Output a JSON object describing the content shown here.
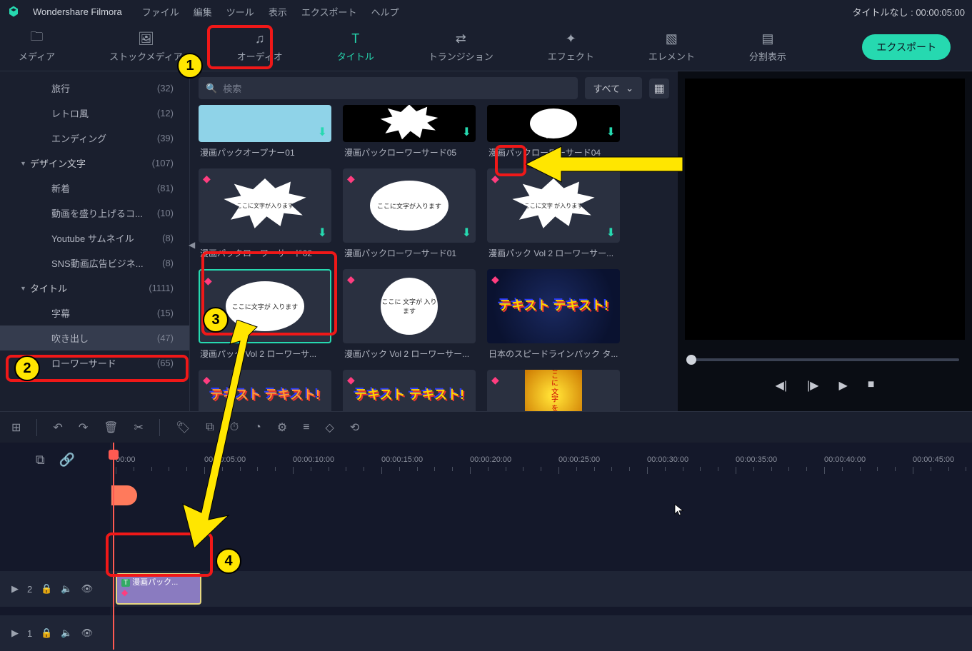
{
  "app": {
    "name": "Wondershare Filmora",
    "title_right": "タイトルなし : 00:00:05:00"
  },
  "menu": [
    "ファイル",
    "編集",
    "ツール",
    "表示",
    "エクスポート",
    "ヘルプ"
  ],
  "tabs": [
    {
      "label": "メディア"
    },
    {
      "label": "ストックメディア"
    },
    {
      "label": "オーディオ"
    },
    {
      "label": "タイトル"
    },
    {
      "label": "トランジション"
    },
    {
      "label": "エフェクト"
    },
    {
      "label": "エレメント"
    },
    {
      "label": "分割表示"
    }
  ],
  "export_label": "エクスポート",
  "search": {
    "placeholder": "検索",
    "filter": "すべて"
  },
  "sidebar": [
    {
      "label": "旅行",
      "count": "(32)",
      "type": "item"
    },
    {
      "label": "レトロ風",
      "count": "(12)",
      "type": "item"
    },
    {
      "label": "エンディング",
      "count": "(39)",
      "type": "item"
    },
    {
      "label": "デザイン文字",
      "count": "(107)",
      "type": "group"
    },
    {
      "label": "新着",
      "count": "(81)",
      "type": "item"
    },
    {
      "label": "動画を盛り上げるコ...",
      "count": "(10)",
      "type": "item"
    },
    {
      "label": "Youtube サムネイル",
      "count": "(8)",
      "type": "item"
    },
    {
      "label": "SNS動画広告ビジネ...",
      "count": "(8)",
      "type": "item"
    },
    {
      "label": "タイトル",
      "count": "(1111)",
      "type": "group"
    },
    {
      "label": "字幕",
      "count": "(15)",
      "type": "item"
    },
    {
      "label": "吹き出し",
      "count": "(47)",
      "type": "item",
      "selected": true
    },
    {
      "label": "ローワーサード",
      "count": "(65)",
      "type": "item"
    }
  ],
  "grid": [
    [
      {
        "label": "漫画パックオープナー01",
        "half": true,
        "style": "blue"
      },
      {
        "label": "漫画パックローワーサード05",
        "half": true,
        "style": "black-spiky"
      },
      {
        "label": "漫画パックローワーサード04",
        "half": true,
        "style": "black-bubble"
      }
    ],
    [
      {
        "label": "漫画パックローワーサード02",
        "style": "spiky",
        "text": "ここに文字が入ります"
      },
      {
        "label": "漫画パックローワーサード01",
        "style": "bubble",
        "text": "ここに文字が入ります"
      },
      {
        "label": "漫画パック Vol 2 ローワーサー...",
        "style": "spiky",
        "text": "ここに文字\\nが入ります"
      }
    ],
    [
      {
        "label": "漫画パック Vol 2 ローワーサ...",
        "style": "bubble",
        "text": "ここに文字が\\n入ります",
        "selected": true
      },
      {
        "label": "漫画パック Vol 2 ローワーサー...",
        "style": "bubble",
        "text": "ここに\\n文字が\\n入ります"
      },
      {
        "label": "日本のスピードラインパック タ...",
        "style": "blueburst",
        "text": "テキスト\\nテキスト!"
      }
    ],
    [
      {
        "label": "",
        "style": "text1",
        "partial": true,
        "text": "テキスト\\nテキスト!"
      },
      {
        "label": "",
        "style": "text1",
        "partial": true,
        "text": "テキスト\\nテキスト!"
      },
      {
        "label": "",
        "style": "yellowburst",
        "partial": true,
        "text": "ここに\\n文字\\nを入力"
      }
    ]
  ],
  "ruler": [
    "00:00",
    "00:00:05:00",
    "00:00:10:00",
    "00:00:15:00",
    "00:00:20:00",
    "00:00:25:00",
    "00:00:30:00",
    "00:00:35:00",
    "00:00:40:00",
    "00:00:45:00"
  ],
  "tracks": {
    "t2_label": "2",
    "t1_label": "1"
  },
  "clip": {
    "label": "漫画パック...",
    "icon": "T"
  }
}
